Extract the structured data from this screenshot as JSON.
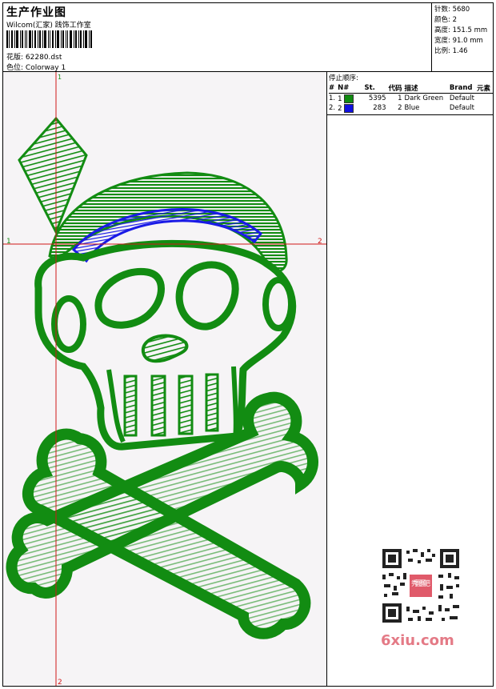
{
  "header": {
    "title": "生产作业图",
    "studio": "Wilcom(汇家) 践饰工作室",
    "design_label": "花版:",
    "design_file": "62280.dst",
    "colorway_label": "色位:",
    "colorway": "Colorway 1"
  },
  "stats": {
    "stitches_label": "针数:",
    "stitches": "5680",
    "colors_label": "颜色:",
    "colors": "2",
    "height_label": "高度:",
    "height": "151.5 mm",
    "width_label": "宽度:",
    "width": "91.0 mm",
    "ratio_label": "比例:",
    "ratio": "1.46"
  },
  "stop_sequence": {
    "title": "停止顺序:",
    "columns": [
      "#",
      "N#",
      "St.",
      "代码",
      "描述",
      "Brand",
      "元素"
    ],
    "rows": [
      {
        "idx": "1.",
        "n": "1",
        "color": "#108c10",
        "stitches": "5395",
        "code": "1",
        "desc": "Dark Green",
        "brand": "Default"
      },
      {
        "idx": "2.",
        "n": "2",
        "color": "#1010e0",
        "stitches": "283",
        "code": "2",
        "desc": "Blue",
        "brand": "Default"
      }
    ]
  },
  "guides": {
    "vertical_top": "1",
    "vertical_bottom": "2",
    "horizontal_left": "1",
    "horizontal_right": "2"
  },
  "colors": {
    "green": "#128c12",
    "blue": "#1a1ae6",
    "guide": "#d01818"
  },
  "watermark": "6xiu.com",
  "qr_badge": "秀图图吧"
}
